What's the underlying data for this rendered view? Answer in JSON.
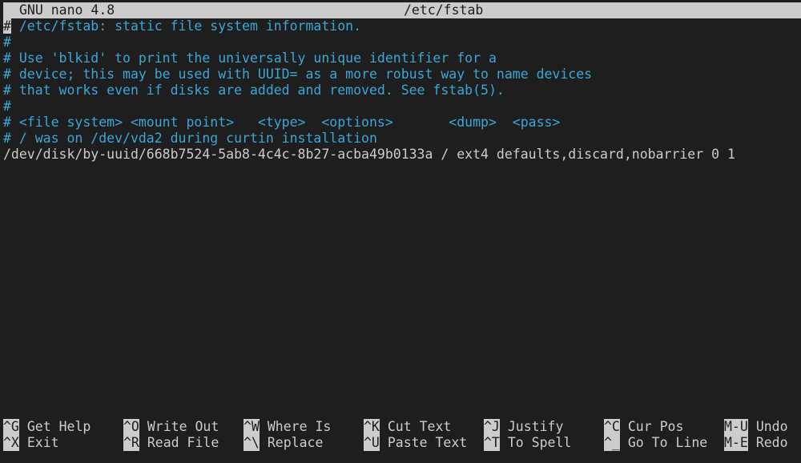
{
  "title_bar": {
    "app": "GNU nano 4.8",
    "filename": "/etc/fstab"
  },
  "cursor_char": "#",
  "lines": [
    {
      "text": " /etc/fstab: static file system information.",
      "type": "comment"
    },
    {
      "text": "#",
      "type": "comment"
    },
    {
      "text": "# Use 'blkid' to print the universally unique identifier for a",
      "type": "comment"
    },
    {
      "text": "# device; this may be used with UUID= as a more robust way to name devices",
      "type": "comment"
    },
    {
      "text": "# that works even if disks are added and removed. See fstab(5).",
      "type": "comment"
    },
    {
      "text": "#",
      "type": "comment"
    },
    {
      "text": "# <file system> <mount point>   <type>  <options>       <dump>  <pass>",
      "type": "comment"
    },
    {
      "text": "# / was on /dev/vda2 during curtin installation",
      "type": "comment"
    },
    {
      "text": "/dev/disk/by-uuid/668b7524-5ab8-4c4c-8b27-acba49b0133a / ext4 defaults,discard,nobarrier 0 1",
      "type": "plain"
    }
  ],
  "shortcuts": [
    [
      {
        "key": "^G",
        "label": "Get Help"
      },
      {
        "key": "^X",
        "label": "Exit"
      }
    ],
    [
      {
        "key": "^O",
        "label": "Write Out"
      },
      {
        "key": "^R",
        "label": "Read File"
      }
    ],
    [
      {
        "key": "^W",
        "label": "Where Is"
      },
      {
        "key": "^\\",
        "label": "Replace"
      }
    ],
    [
      {
        "key": "^K",
        "label": "Cut Text"
      },
      {
        "key": "^U",
        "label": "Paste Text"
      }
    ],
    [
      {
        "key": "^J",
        "label": "Justify"
      },
      {
        "key": "^T",
        "label": "To Spell"
      }
    ],
    [
      {
        "key": "^C",
        "label": "Cur Pos"
      },
      {
        "key": "^_",
        "label": "Go To Line"
      }
    ],
    [
      {
        "key": "M-U",
        "label": "Undo"
      },
      {
        "key": "M-E",
        "label": "Redo"
      }
    ]
  ],
  "colors": {
    "background": "#1e1e1e",
    "foreground": "#cccccc",
    "comment": "#3aa7d8",
    "inverse_bg": "#cccccc"
  }
}
